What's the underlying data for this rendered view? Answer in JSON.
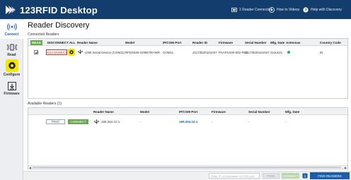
{
  "app": {
    "title": "123RFID Desktop",
    "colors": {
      "titlebar": "#123d6c",
      "accent": "#1c5fa8",
      "connect_green": "#6aa84f",
      "configure_yellow": "#f3e600",
      "disconnect_red": "#c0392b"
    }
  },
  "titlebar": {
    "reader_connected": "1 Reader Connected",
    "how_to_videos": "How to Videos",
    "help": "Help with Discovery"
  },
  "sidebar": {
    "items": [
      {
        "label": "Connect",
        "icon": "antenna-icon",
        "active": true
      },
      {
        "label": "Read",
        "icon": "read-icon",
        "active": false
      },
      {
        "label": "Configure",
        "icon": "gear-icon",
        "active": false
      },
      {
        "label": "Firmware",
        "icon": "firmware-download-icon",
        "active": false
      }
    ]
  },
  "page": {
    "title": "Reader Discovery",
    "connected_label": "Connected Readers",
    "available_label": "Available Readers (1)"
  },
  "connected": {
    "read_button": "READ",
    "headers": {
      "disconnect_all": "DISCONNECT ALL",
      "reader_name": "Reader Name",
      "model": "Model",
      "ip_com_port": "IP/COM Port",
      "reader_id": "Reader ID",
      "firmware": "Firmware",
      "serial_number": "Serial Number",
      "mfg_date": "Mfg. Date",
      "antennas": "Antennas",
      "country_code": "Country Code"
    },
    "rows": [
      {
        "checked": true,
        "disconnect": "DISCONNECT",
        "reader_name": "USB Serial Device (COM11)",
        "model": "RFD4030-G00B700-WR",
        "ip_com_port": "COM11",
        "reader_id": "21173520101047",
        "firmware": "PAAFKS00-002-R02",
        "serial_number": "21173520101047",
        "mfg_date": "22Jun21",
        "antenna_status": "connected",
        "country_code": "IN"
      }
    ]
  },
  "available": {
    "headers": {
      "reader_name": "Reader Name",
      "model": "Model",
      "ip_com_port": "IP/COM Port",
      "firmware": "Firmware",
      "serial_number": "Serial Number",
      "mfg_date": "Mfg. Date"
    },
    "rows": [
      {
        "ping": "PING",
        "connect": "CONNECT",
        "reader_name": "169.254.10.1",
        "model": "-",
        "ip_com_port": "169.254.10.1",
        "firmware": "-",
        "serial_number": "-",
        "mfg_date": "-"
      }
    ]
  },
  "bottombar": {
    "ip_placeholder": "Enter IP or Hostname or COM port",
    "ping": "PING",
    "connect": "CONNECT",
    "find_readers": "FIND READERS"
  }
}
